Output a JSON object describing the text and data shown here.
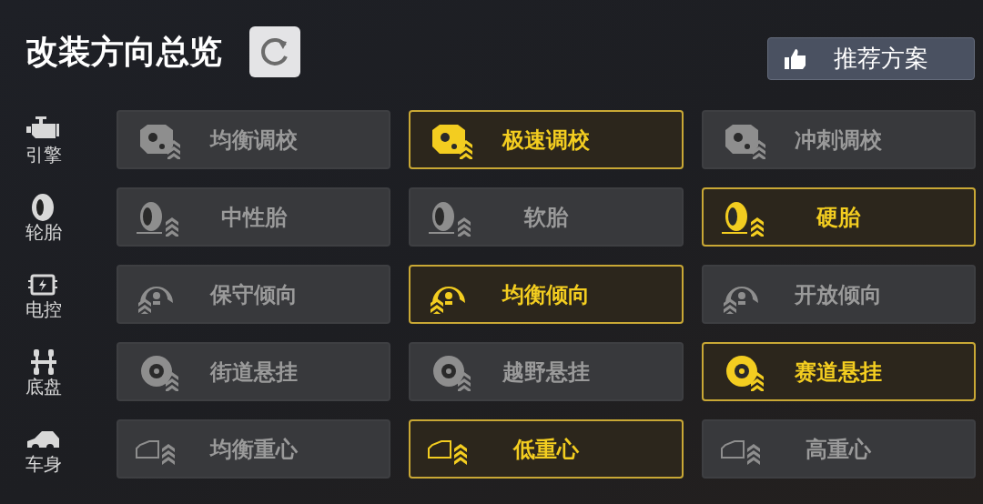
{
  "title": "改装方向总览",
  "recommend_button": "推荐方案",
  "rows": [
    {
      "kind": "engine",
      "label": "引擎",
      "options": [
        {
          "label": "均衡调校",
          "selected": false
        },
        {
          "label": "极速调校",
          "selected": true
        },
        {
          "label": "冲刺调校",
          "selected": false
        }
      ]
    },
    {
      "kind": "tire",
      "label": "轮胎",
      "options": [
        {
          "label": "中性胎",
          "selected": false
        },
        {
          "label": "软胎",
          "selected": false
        },
        {
          "label": "硬胎",
          "selected": true
        }
      ]
    },
    {
      "kind": "ecu",
      "label": "电控",
      "options": [
        {
          "label": "保守倾向",
          "selected": false
        },
        {
          "label": "均衡倾向",
          "selected": true
        },
        {
          "label": "开放倾向",
          "selected": false
        }
      ]
    },
    {
      "kind": "chassis",
      "label": "底盘",
      "options": [
        {
          "label": "街道悬挂",
          "selected": false
        },
        {
          "label": "越野悬挂",
          "selected": false
        },
        {
          "label": "赛道悬挂",
          "selected": true
        }
      ]
    },
    {
      "kind": "body",
      "label": "车身",
      "options": [
        {
          "label": "均衡重心",
          "selected": false
        },
        {
          "label": "低重心",
          "selected": true
        },
        {
          "label": "高重心",
          "selected": false
        }
      ]
    }
  ]
}
